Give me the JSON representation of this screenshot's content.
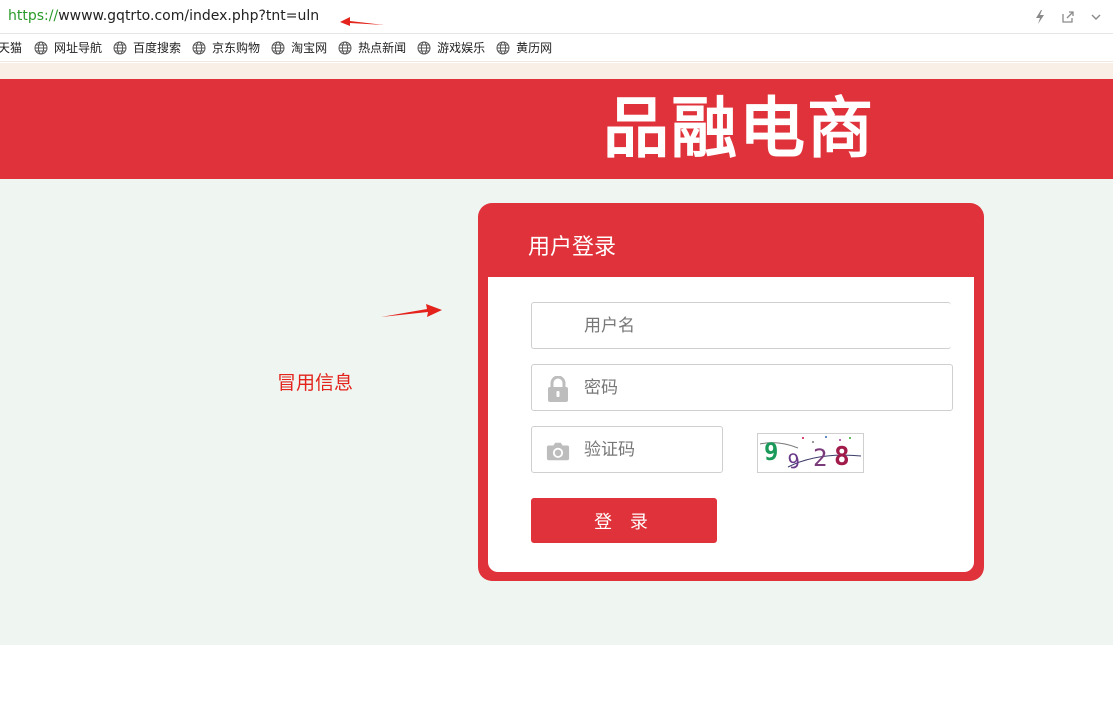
{
  "browser": {
    "url_scheme": "https",
    "url_sep": "://",
    "url_rest": "wwww.gqtrto.com/index.php?tnt=uln"
  },
  "bookmarks": [
    "天猫",
    "网址导航",
    "百度搜索",
    "京东购物",
    "淘宝网",
    "热点新闻",
    "游戏娱乐",
    "黄历网"
  ],
  "header": {
    "brand": "品融电商",
    "brand_color": "#e0323a"
  },
  "annotation": {
    "text": "冒用信息",
    "color": "#e3231c"
  },
  "login": {
    "title": "用户登录",
    "username_placeholder": "用户名",
    "password_placeholder": "密码",
    "captcha_placeholder": "验证码",
    "captcha_code": "9928",
    "submit_label": "登 录"
  }
}
